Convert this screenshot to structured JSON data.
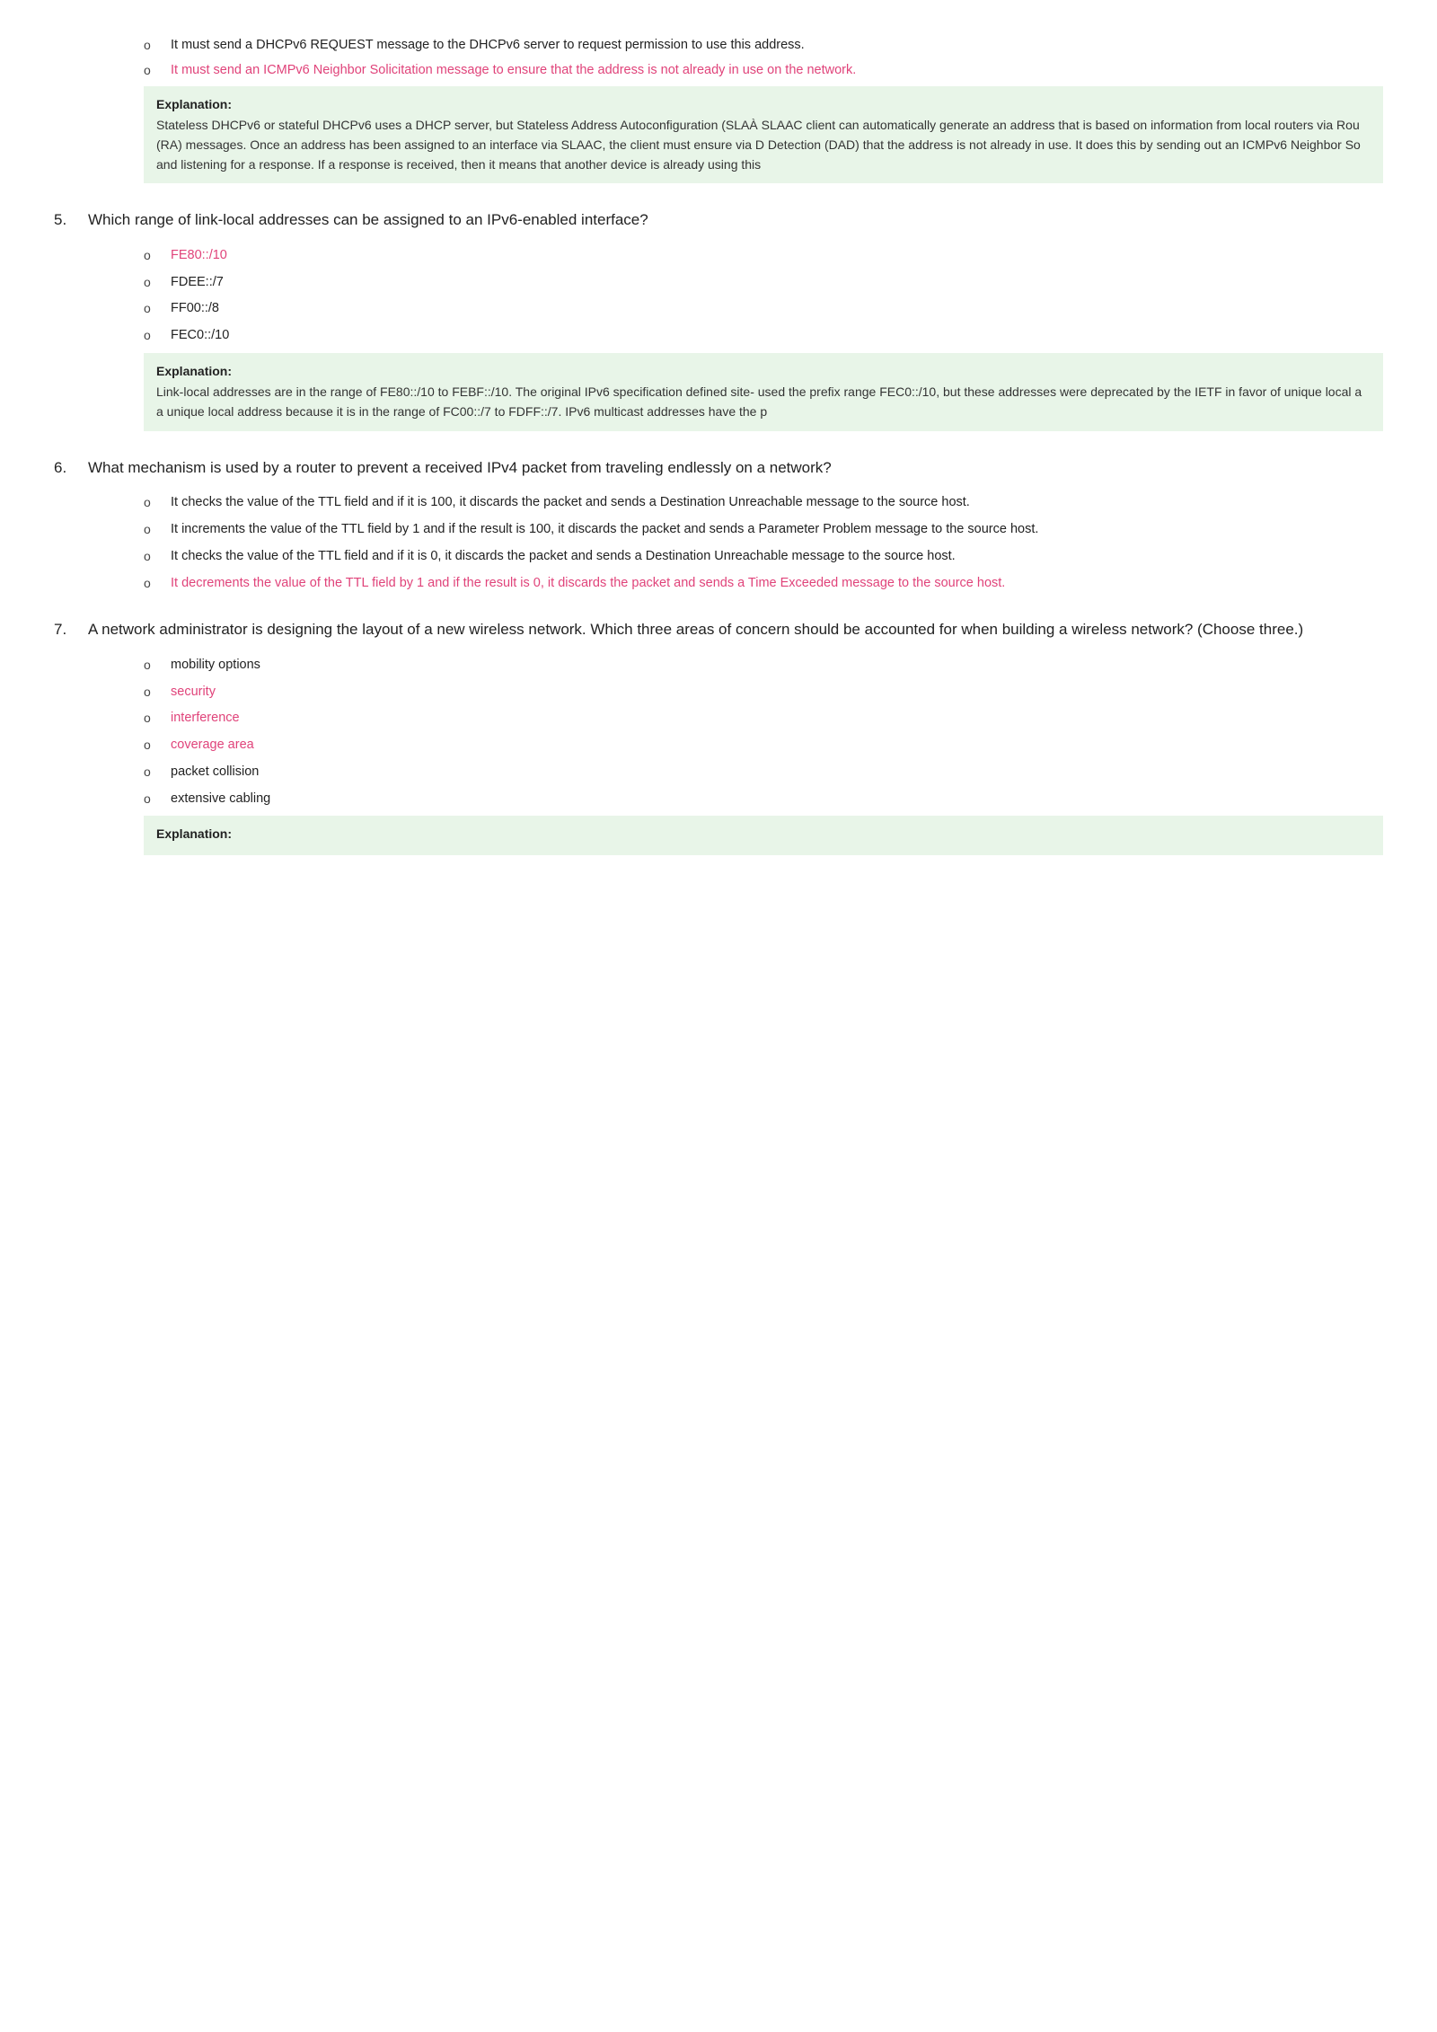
{
  "page": {
    "top_bullets": [
      {
        "id": "tb1",
        "text": "It must send a DHCPv6 REQUEST message to the DHCPv6 server to request permission to use this address.",
        "correct": false
      },
      {
        "id": "tb2",
        "text": "It must send an ICMPv6 Neighbor Solicitation message to ensure that the address is not already in use on the network.",
        "correct": true
      }
    ],
    "top_explanation_label": "Explanation:",
    "top_explanation_text": "Stateless DHCPv6 or stateful DHCPv6 uses a DHCP server, but Stateless Address Autoconfiguration (SLAÀ SLAAC client can automatically generate an address that is based on information from local routers via Rou (RA) messages. Once an address has been assigned to an interface via SLAAC, the client must ensure via D Detection (DAD) that the address is not already in use. It does this by sending out an ICMPv6 Neighbor So and listening for a response. If a response is received, then it means that another device is already using this",
    "questions": [
      {
        "num": "5.",
        "text": "Which range of link-local addresses can be assigned to an IPv6-enabled interface?",
        "options": [
          {
            "text": "FE80::/10",
            "correct": true
          },
          {
            "text": "FDEE::/7",
            "correct": false
          },
          {
            "text": "FF00::/8",
            "correct": false
          },
          {
            "text": "FEC0::/10",
            "correct": false
          }
        ],
        "explanation_label": "Explanation:",
        "explanation_text": "Link-local addresses are in the range of FE80::/10 to FEBF::/10. The original IPv6 specification defined site- used the prefix range FEC0::/10, but these addresses were deprecated by the IETF in favor of unique local a a unique local address because it is in the range of FC00::/7 to FDFF::/7. IPv6 multicast addresses have the p"
      },
      {
        "num": "6.",
        "text": "What mechanism is used by a router to prevent a received IPv4 packet from traveling endlessly on a network?",
        "options": [
          {
            "text": "It checks the value of the TTL field and if it is 100, it discards the packet and sends a Destination Unreachable message to the source host.",
            "correct": false
          },
          {
            "text": "It increments the value of the TTL field by 1 and if the result is 100, it discards the packet and sends a Parameter Problem message to the source host.",
            "correct": false
          },
          {
            "text": "It checks the value of the TTL field and if it is 0, it discards the packet and sends a Destination Unreachable message to the source host.",
            "correct": false
          },
          {
            "text": "It decrements the value of the TTL field by 1 and if the result is 0, it discards the packet and sends a Time Exceeded message to the source host.",
            "correct": true
          }
        ],
        "explanation_label": null,
        "explanation_text": null
      },
      {
        "num": "7.",
        "text": "A network administrator is designing the layout of a new wireless network. Which three areas of concern should be accounted for when building a wireless network? (Choose three.)",
        "options": [
          {
            "text": "mobility options",
            "correct": false
          },
          {
            "text": "security",
            "correct": true
          },
          {
            "text": "interference",
            "correct": true
          },
          {
            "text": "coverage area",
            "correct": true
          },
          {
            "text": "packet collision",
            "correct": false
          },
          {
            "text": "extensive cabling",
            "correct": false
          }
        ],
        "explanation_label": "Explanation:",
        "explanation_text": null
      }
    ],
    "bullet_symbol": "o",
    "correct_color": "#e0437a",
    "explanation_bg": "#e8f5e8"
  }
}
